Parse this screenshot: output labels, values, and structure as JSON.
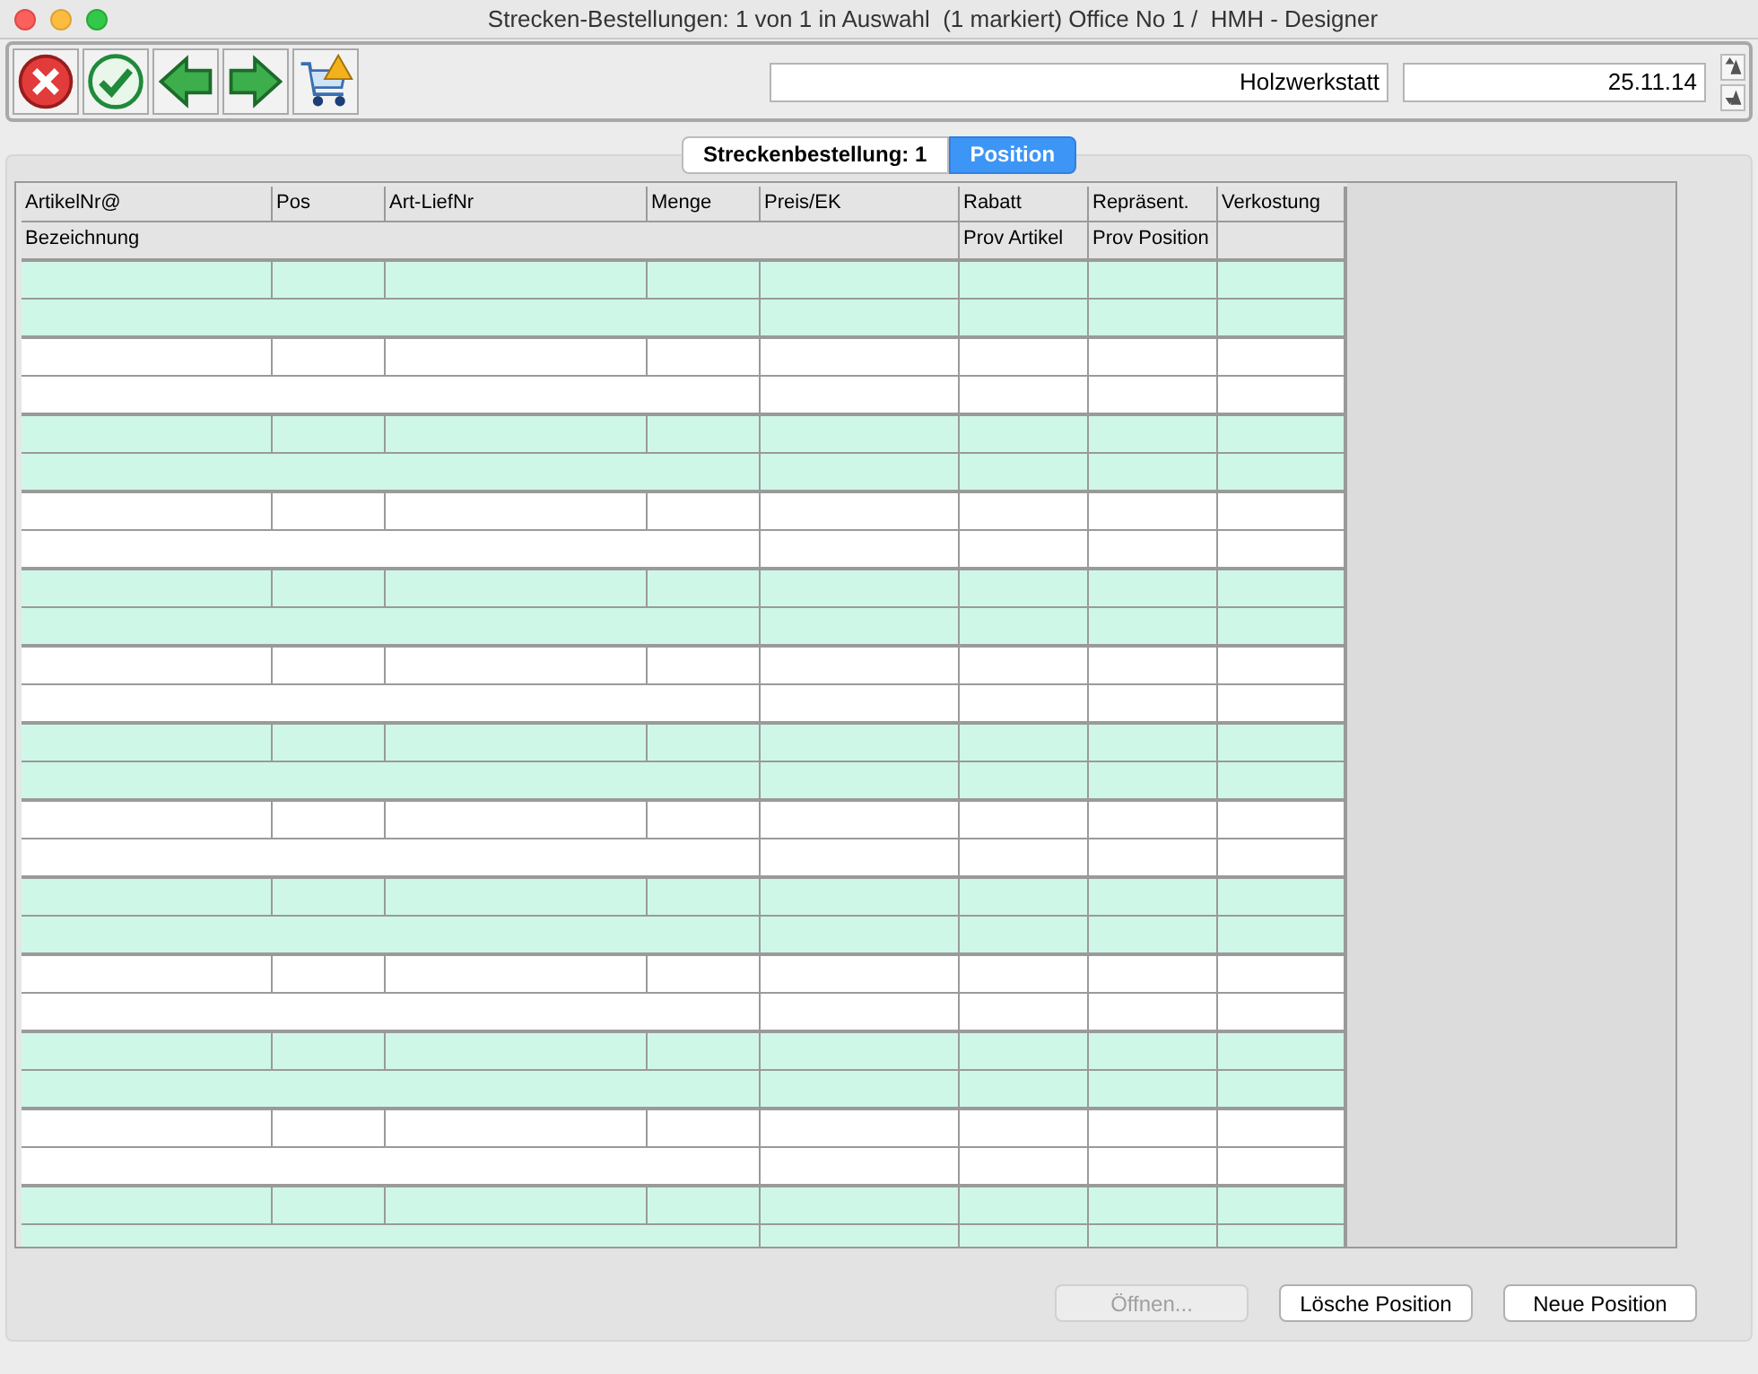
{
  "window": {
    "title": "Strecken-Bestellungen: 1 von 1 in Auswahl  (1 markiert) Office No 1 /  HMH - Designer"
  },
  "toolbar": {
    "fields": [
      {
        "value": "Holzwerkstatt"
      },
      {
        "value": "25.11.14"
      }
    ]
  },
  "tabs": [
    {
      "label": "Streckenbestellung: 1",
      "selected": false
    },
    {
      "label": "Position",
      "selected": true
    }
  ],
  "table": {
    "columns_row_1": [
      "ArtikelNr@",
      "Pos",
      "Art-LiefNr",
      "Menge",
      "Preis/EK",
      "Rabatt",
      "Repräsent.",
      "Verkostung"
    ],
    "columns_row_2": [
      "Bezeichnung",
      "Prov Artikel",
      "Prov Position"
    ]
  },
  "buttons": [
    {
      "label": "Öffnen...",
      "disabled": true
    },
    {
      "label": "Lösche Position",
      "disabled": false
    },
    {
      "label": "Neue Position",
      "disabled": false
    }
  ]
}
